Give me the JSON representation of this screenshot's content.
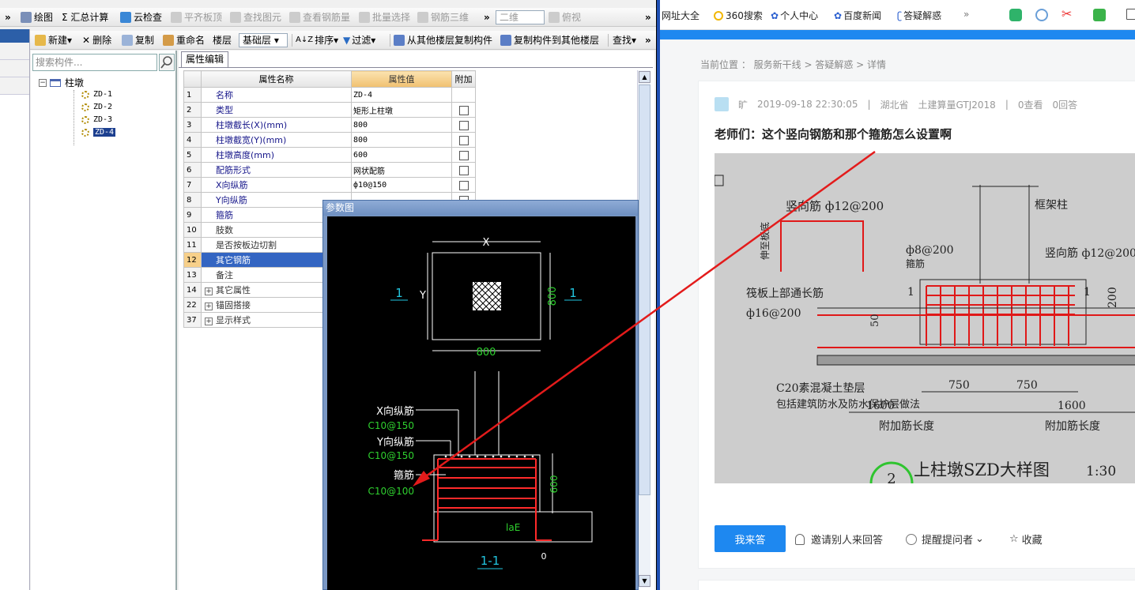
{
  "toolbar1": {
    "items": [
      "绘图",
      "Σ 汇总计算",
      "云检查",
      "平齐板顶",
      "查找图元",
      "查看钢筋量",
      "批量选择",
      "钢筋三维"
    ],
    "view_mode": "二维",
    "view_dir": "俯视",
    "more": "»"
  },
  "toolbar2": {
    "new": "新建",
    "delete": "删除",
    "copy": "复制",
    "rename": "重命名",
    "floor_label": "楼层",
    "floor_value": "基础层",
    "sort": "排序",
    "filter": "过滤",
    "copy_from_floor": "从其他楼层复制构件",
    "copy_to_floor": "复制构件到其他楼层",
    "find": "查找",
    "more": "»"
  },
  "tree": {
    "search_placeholder": "搜索构件...",
    "root": "柱墩",
    "items": [
      "ZD-1",
      "ZD-2",
      "ZD-3",
      "ZD-4"
    ],
    "selected": "ZD-4"
  },
  "props": {
    "tab": "属性编辑",
    "headers": {
      "name": "属性名称",
      "value": "属性值",
      "extra": "附加"
    },
    "rows": [
      {
        "num": "1",
        "name": "名称",
        "value": "ZD-4",
        "check": false
      },
      {
        "num": "2",
        "name": "类型",
        "value": "矩形上柱墩",
        "check": true
      },
      {
        "num": "3",
        "name": "柱墩截长(X)(mm)",
        "value": "800",
        "check": true
      },
      {
        "num": "4",
        "name": "柱墩截宽(Y)(mm)",
        "value": "800",
        "check": true
      },
      {
        "num": "5",
        "name": "柱墩高度(mm)",
        "value": "600",
        "check": true
      },
      {
        "num": "6",
        "name": "配筋形式",
        "value": "网状配筋",
        "check": true
      },
      {
        "num": "7",
        "name": "X向纵筋",
        "value": "ф10@150",
        "check": true
      },
      {
        "num": "8",
        "name": "Y向纵筋",
        "value": "",
        "check": true
      },
      {
        "num": "9",
        "name": "箍筋",
        "value": "",
        "check": false
      },
      {
        "num": "10",
        "name": "肢数",
        "value": "",
        "check": false
      },
      {
        "num": "11",
        "name": "是否按板边切割",
        "value": "",
        "check": false
      },
      {
        "num": "12",
        "name": "其它钢筋",
        "value": "",
        "check": false
      },
      {
        "num": "13",
        "name": "备注",
        "value": "",
        "check": false
      },
      {
        "num": "14",
        "name": "其它属性",
        "value": "",
        "check": false
      },
      {
        "num": "22",
        "name": "锚固搭接",
        "value": "",
        "check": false
      },
      {
        "num": "37",
        "name": "显示样式",
        "value": "",
        "check": false
      }
    ]
  },
  "diagram": {
    "title": "参数图",
    "dim_x": "X",
    "dim_y": "Y",
    "dim_800_h": "800",
    "dim_800_v": "800",
    "section_mark": "1",
    "label_x_bar": "X向纵筋",
    "val_x_bar": "C10@150",
    "label_y_bar": "Y向纵筋",
    "val_y_bar": "C10@150",
    "label_stirrup": "箍筋",
    "val_stirrup": "C10@100",
    "dim_600": "600",
    "lae": "laE",
    "dim_0": "0",
    "section_title": "1-1"
  },
  "browser": {
    "bookmarks": [
      "网址大全",
      "360搜索",
      "个人中心",
      "百度新闻",
      "答疑解惑"
    ],
    "more": "»",
    "breadcrumb": "当前位置 ： 服务新干线 > 答疑解惑 > 详情",
    "author": "旷",
    "date": "2019-09-18 22:30:05",
    "region": "湖北省",
    "software": "土建算量GTJ2018",
    "views": "0查看",
    "answers": "0回答",
    "question_title": "老师们：这个竖向钢筋和那个箍筋怎么设置啊",
    "answer_btn": "我来答",
    "invite": "邀请别人来回答",
    "remind": "提醒提问者",
    "favorite": "收藏"
  },
  "drawing": {
    "vert_bar_left": "竖向筋 ф12@200",
    "frame_col": "框架柱",
    "tie": "ф8@200",
    "tie_label": "箍筋",
    "vert_bar_right": "竖向筋 ф12@200",
    "slab_top": "筏板上部通长筋",
    "slab_top_val": "ф16@200",
    "d1": "1",
    "d2": "1",
    "d200": "200",
    "d50": "50",
    "c20": "C20素混凝土垫层",
    "c20b": "包括建筑防水及防水保护层做法",
    "d750a": "750",
    "d750b": "750",
    "d1600a": "1600",
    "d1600b": "1600",
    "add_len_a": "附加筋长度",
    "add_len_b": "附加筋长度",
    "title": "上柱墩SZD大样图",
    "scale": "1:30",
    "circle_no": "2",
    "side_label": "伸至板底"
  },
  "colors": {
    "accent_blue": "#1e88f0",
    "dwg_green": "#2fd12f",
    "dwg_cyan": "#22c6e0",
    "dwg_red": "#ff2a2a",
    "arrow_red": "#e31b1b"
  }
}
